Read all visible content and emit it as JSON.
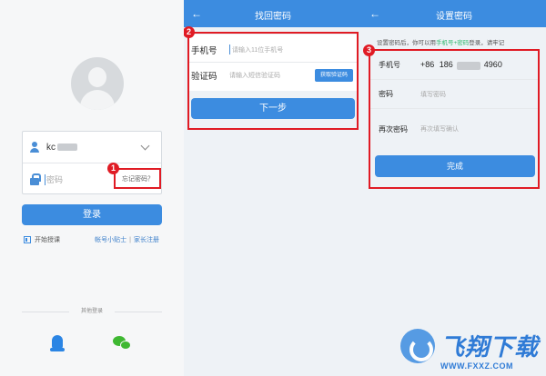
{
  "login_screen": {
    "username": "kc",
    "username_chevron_icon": "chevron-down-icon",
    "password_placeholder": "密码",
    "forgot_password": "忘记密码？",
    "login_button": "登录",
    "trial_link": "开始授课",
    "account_tips_link": "帐号小贴士",
    "link_separator": "|",
    "parent_register_link": "家长注册",
    "other_login_label": "其他登录",
    "social_icons": [
      "qq-icon",
      "wechat-icon"
    ]
  },
  "find_password": {
    "back_icon": "←",
    "title": "找回密码",
    "phone_label": "手机号",
    "phone_placeholder": "请输入11位手机号",
    "code_label": "验证码",
    "code_placeholder": "请输入短信验证码",
    "get_code_button": "获取验证码",
    "next_button": "下一步"
  },
  "set_password": {
    "back_icon": "←",
    "title": "设置密码",
    "hint_prefix": "设置密码后，你可以用",
    "hint_highlight": "手机号+密码",
    "hint_suffix": "登录，请牢记",
    "phone_label": "手机号",
    "phone_prefix": "+86  186",
    "phone_suffix": "4960",
    "password_label": "密码",
    "password_placeholder": "填写密码",
    "confirm_label": "再次密码",
    "confirm_placeholder": "再次填写确认",
    "done_button": "完成"
  },
  "step_badges": [
    "1",
    "2",
    "3"
  ],
  "watermark": {
    "brand_cn": "飞翔下载",
    "brand_en": "WWW.FXXZ.COM"
  },
  "colors": {
    "primary": "#3c8ce0",
    "highlight_box": "#e01b24",
    "hint_highlight": "#2db86d"
  }
}
